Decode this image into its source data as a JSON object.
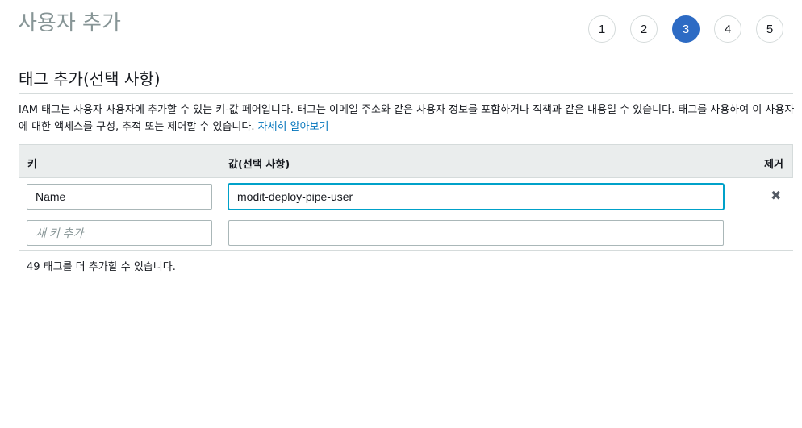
{
  "page": {
    "title": "사용자 추가"
  },
  "steps": [
    {
      "label": "1",
      "active": false
    },
    {
      "label": "2",
      "active": false
    },
    {
      "label": "3",
      "active": true
    },
    {
      "label": "4",
      "active": false
    },
    {
      "label": "5",
      "active": false
    }
  ],
  "section": {
    "title": "태그 추가(선택 사항)",
    "description": "IAM 태그는 사용자 사용자에 추가할 수 있는 키-값 페어입니다. 태그는 이메일 주소와 같은 사용자 정보를 포함하거나 직책과 같은 내용일 수 있습니다. 태그를 사용하여 이 사용자에 대한 액세스를 구성, 추적 또는 제어할 수 있습니다.",
    "learn_more": "자세히 알아보기"
  },
  "table": {
    "headers": {
      "key": "키",
      "value": "값(선택 사항)",
      "remove": "제거"
    },
    "rows": [
      {
        "key": "Name",
        "value": "modit-deploy-pipe-user"
      },
      {
        "key": "",
        "value": ""
      }
    ],
    "new_key_placeholder": "새 키 추가",
    "remove_icon": "close-icon",
    "remaining_text": "49 태그를 더 추가할 수 있습니다."
  },
  "colors": {
    "accent": "#2d6bc4",
    "link": "#0073bb",
    "focus": "#00a1c9",
    "header_bg": "#eaeded",
    "title_gray": "#879596"
  }
}
